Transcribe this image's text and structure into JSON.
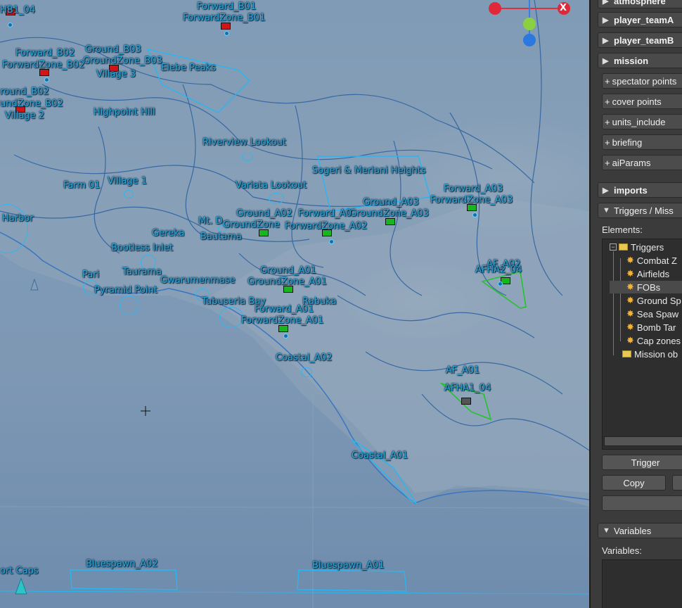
{
  "map_labels": {
    "hb1_04": "HB1_04",
    "forward_b01": "Forward_B01",
    "forwardzone_b01": "ForwardZone_B01",
    "forward_b02": "Forward_B02",
    "ground_b03": "Ground_B03",
    "groundzone_b03": "GroundZone_B03",
    "forwardzone_b02": "ForwardZone_B02",
    "village3": "Village 3",
    "elebe_peaks": "Elebe Peaks",
    "ground_b02": "round_B02",
    "groundzone_b02": "undZone_B02",
    "village2": "Village 2",
    "highpoint_hill": "Highpoint Hill",
    "riverview": "Riverview Lookout",
    "sogeri": "Sogeri & Meriani Heights",
    "farm01": "Farm 01",
    "village1": "Village 1",
    "variata": "Variata Lookout",
    "forward_a03": "Forward_A03",
    "forwardzone_a03": "ForwardZone_A03",
    "ground_a03": "Ground_A03",
    "groundzone_a03": "GroundZone_A03",
    "harbor": "Harbor",
    "ground_a02": "Ground_A02",
    "forward_a02": "Forward_A0",
    "mt_d": "Mt. D",
    "groundzone_a02": "GroundZone",
    "forwardzone_a02": "ForwardZone_A02",
    "gereka": "Gereka",
    "bautama": "Bautama",
    "bootless": "Bootless Inlet",
    "af_a02": "AF_A02",
    "afha2_04": "AFHA2_04",
    "pari": "Pari",
    "taurama": "Taurama",
    "gwarumenmase": "Gwarumenmase",
    "pyramid": "Pyramid Point",
    "ground_a01": "Ground_A01",
    "groundzone_a01": "GroundZone_A01",
    "tubuseria": "Tubuseria Bay",
    "rabuka": "Rabuka",
    "forward_a01": "Forward_A01",
    "forwardzone_a01": "ForwardZone_A01",
    "coastal_a02": "Coastal_A02",
    "af_a01": "AF_A01",
    "afha1_04": "AFHA1_04",
    "coastal_a01": "Coastal_A01",
    "bluespawn_a02": "Bluespawn_A02",
    "bluespawn_a01": "Bluespawn_A01",
    "port_caps": "ort Caps"
  },
  "gizmo": {
    "x_label": "X"
  },
  "panel": {
    "atmosphere": "atmosphere",
    "player_teamA": "player_teamA",
    "player_teamB": "player_teamB",
    "mission": "mission",
    "spectator_points": "spectator points",
    "cover_points": "cover points",
    "units_include": "units_include",
    "briefing": "briefing",
    "aiParams": "aiParams",
    "imports": "imports",
    "triggers": "Triggers / Miss",
    "elements_label": "Elements:",
    "tree": {
      "root": "Triggers",
      "items": [
        "Combat Z",
        "Airfields",
        "FOBs",
        "Ground Sp",
        "Sea Spaw",
        "Bomb Tar",
        "Cap zones"
      ],
      "mission_obj": "Mission ob"
    },
    "trigger_button": "Trigger",
    "copy_button": "Copy",
    "variables_head": "Variables",
    "variables_label": "Variables:"
  },
  "colors": {
    "label": "#2fa8d8",
    "red_team": "#d0141a",
    "green_team": "#18b521",
    "panel_bg": "#3b3b3b"
  }
}
